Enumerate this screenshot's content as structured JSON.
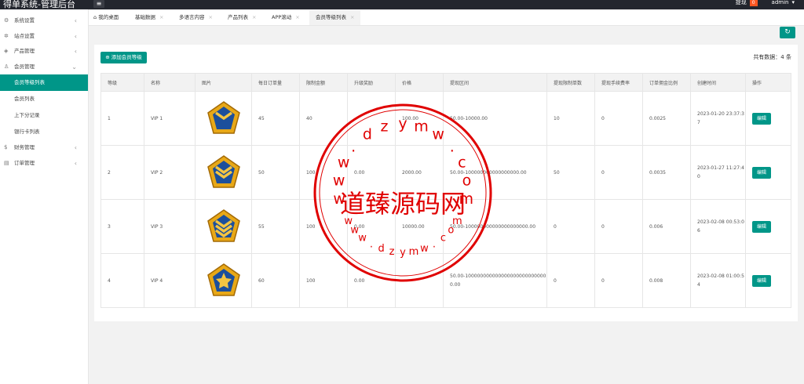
{
  "header": {
    "title": "得单系统-管理后台",
    "menu_icon": "≡",
    "notice_label": "提现",
    "notice_count": "0",
    "user": "admin"
  },
  "sidebar": {
    "items": [
      {
        "label": "系统设置",
        "icon": "gear-icon"
      },
      {
        "label": "站点设置",
        "icon": "cog-icon"
      },
      {
        "label": "产品管理",
        "icon": "cube-icon"
      },
      {
        "label": "会员管理",
        "icon": "user-icon"
      }
    ],
    "member_sub": [
      "会员等级列表",
      "会员列表",
      "上下分记录",
      "银行卡列表"
    ],
    "items_after": [
      {
        "label": "财务管理",
        "icon": "money-icon"
      },
      {
        "label": "订单管理",
        "icon": "order-icon"
      }
    ]
  },
  "tabs": [
    {
      "label": "我的桌面",
      "icon": "home-icon"
    },
    {
      "label": "基础数据"
    },
    {
      "label": "多语言内容"
    },
    {
      "label": "产品列表"
    },
    {
      "label": "APP滚动"
    },
    {
      "label": "会员等级列表"
    }
  ],
  "toolbar": {
    "add_label": "添加会员等级",
    "total_text": "共有数据：4 条"
  },
  "table": {
    "headers": [
      "等级",
      "名称",
      "图片",
      "每日订单量",
      "限制金额",
      "升级奖励",
      "价格",
      "提现区间",
      "提现限制单数",
      "提现手续费率",
      "订单佣金比例",
      "创建时间",
      "操作"
    ],
    "edit_label": "编辑",
    "rows": [
      {
        "level": "1",
        "name": "VIP 1",
        "daily": "45",
        "limit": "40",
        "reward": "",
        "price": "100.00",
        "range": "50.00-10000.00",
        "withdraw_count": "10",
        "fee": "0",
        "commission": "0.0025",
        "created": "2023-01-20 23:37:37",
        "stripes": 1
      },
      {
        "level": "2",
        "name": "VIP 2",
        "daily": "50",
        "limit": "100",
        "reward": "0.00",
        "price": "2000.00",
        "range": "50.00-100000000000000000.00",
        "withdraw_count": "50",
        "fee": "0",
        "commission": "0.0035",
        "created": "2023-01-27 11:27:40",
        "stripes": 2
      },
      {
        "level": "3",
        "name": "VIP 3",
        "daily": "55",
        "limit": "100",
        "reward": "0.00",
        "price": "10000.00",
        "range": "50.00-100000000000000000000.00",
        "withdraw_count": "0",
        "fee": "0",
        "commission": "0.006",
        "created": "2023-02-08 00:53:06",
        "stripes": 3
      },
      {
        "level": "4",
        "name": "VIP 4",
        "daily": "60",
        "limit": "100",
        "reward": "0.00",
        "price": "",
        "range": "50.00-1000000000000000000000000000.00",
        "withdraw_count": "0",
        "fee": "0",
        "commission": "0.008",
        "created": "2023-02-08 01:00:54",
        "stripes": 0
      }
    ]
  },
  "watermark": {
    "center_text": "道臻源码网",
    "letters_top": "w w w . d z y m w . c o m",
    "letters_bottom": "w w w . d z y m w . c o m",
    "color": "#e00000"
  },
  "colors": {
    "accent": "#009688",
    "topbar": "#23262e",
    "badge": "#ff5722"
  }
}
